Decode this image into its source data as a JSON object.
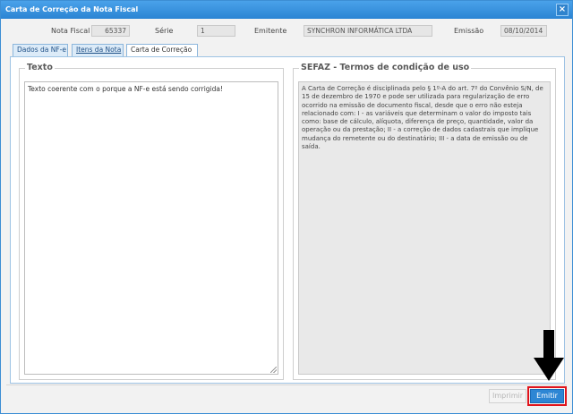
{
  "window": {
    "title": "Carta de Correção da Nota Fiscal",
    "close_glyph": "×"
  },
  "header": {
    "nota_label": "Nota Fiscal",
    "nota_value": "65337",
    "serie_label": "Série",
    "serie_value": "1",
    "emitente_label": "Emitente",
    "emitente_value": "SYNCHRON INFORMÁTICA LTDA",
    "emissao_label": "Emissão",
    "emissao_value": "08/10/2014"
  },
  "tabs": [
    {
      "label": "Dados da NF-e"
    },
    {
      "label": "Itens da Nota"
    },
    {
      "label": "Carta de Correção"
    }
  ],
  "texto": {
    "legend": "Texto",
    "value": "Texto coerente com o porque a NF-e está sendo corrigida!"
  },
  "sefaz": {
    "legend": "SEFAZ - Termos de condição de uso",
    "text": "A Carta de Correção é disciplinada pelo § 1º-A do art. 7º do Convênio S/N, de 15 de dezembro de 1970 e pode ser utilizada para regularização de erro ocorrido na emissão de documento fiscal, desde que o erro não esteja relacionado com: I - as variáveis que determinam o valor do imposto tais como: base de cálculo, alíquota, diferença de preço, quantidade, valor da operação ou da prestação; II - a correção de dados cadastrais que implique mudança do remetente ou do destinatário; III - a data de emissão ou de saída."
  },
  "buttons": {
    "imprimir": "Imprimir",
    "emitir": "Emitir"
  },
  "colors": {
    "titlebar": "#2b84d3",
    "emitir_button": "#2e86d4",
    "highlight_box": "#e0141c",
    "annotation_arrow": "#000000"
  },
  "annotation": {
    "icon": "arrow-down-icon"
  }
}
